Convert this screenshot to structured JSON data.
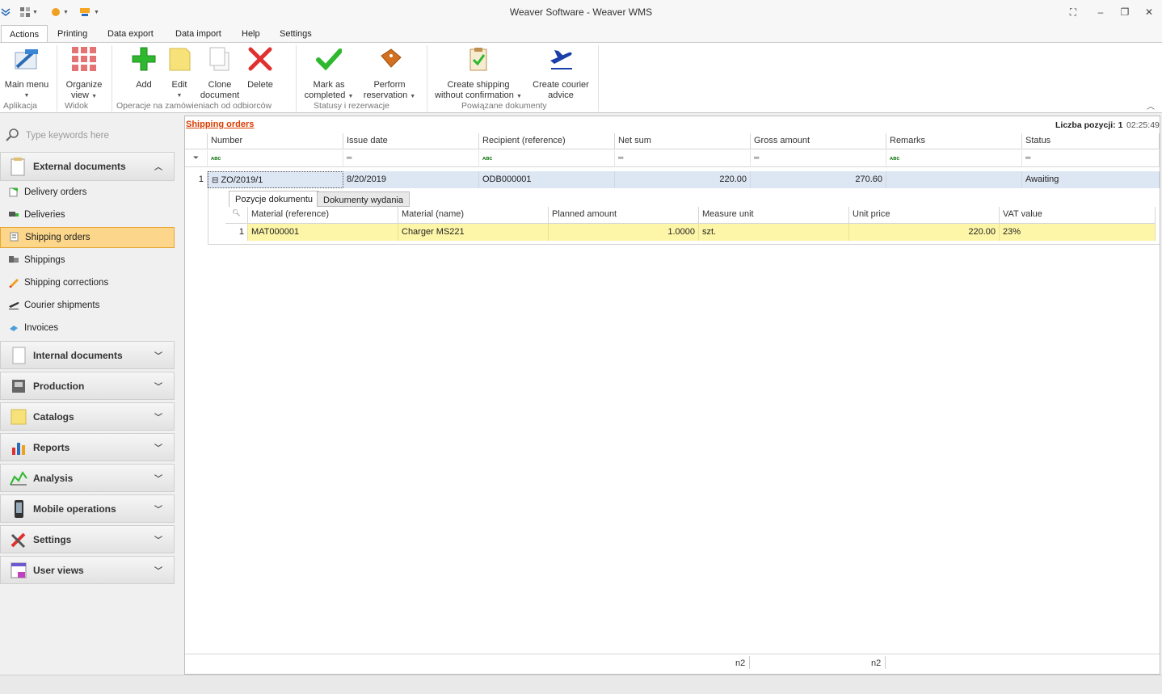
{
  "window": {
    "title": "Weaver Software - Weaver WMS"
  },
  "menu_tabs": [
    {
      "label": "Actions"
    },
    {
      "label": "Printing"
    },
    {
      "label": "Data export"
    },
    {
      "label": "Data import"
    },
    {
      "label": "Help"
    },
    {
      "label": "Settings"
    }
  ],
  "ribbon": {
    "main_menu": "Main menu",
    "organize_view_1": "Organize",
    "organize_view_2": "view",
    "add": "Add",
    "edit": "Edit",
    "clone_1": "Clone",
    "clone_2": "document",
    "delete": "Delete",
    "mark_1": "Mark as",
    "mark_2": "completed",
    "reserve_1": "Perform",
    "reserve_2": "reservation",
    "ship_1": "Create shipping",
    "ship_2": "without confirmation",
    "courier_1": "Create courier",
    "courier_2": "advice",
    "groups": {
      "aplikacja": "Aplikacja",
      "widok": "Widok",
      "operacje": "Operacje na zamówieniach od odbiorców",
      "statusy": "Statusy i rezerwacje",
      "powiazane": "Powiązane dokumenty"
    }
  },
  "sidebar": {
    "search_placeholder": "Type keywords here",
    "external": "External documents",
    "items": [
      {
        "label": "Delivery orders"
      },
      {
        "label": "Deliveries"
      },
      {
        "label": "Shipping orders"
      },
      {
        "label": "Shippings"
      },
      {
        "label": "Shipping corrections"
      },
      {
        "label": "Courier shipments"
      },
      {
        "label": "Invoices"
      }
    ],
    "categories": [
      {
        "label": "Internal documents"
      },
      {
        "label": "Production"
      },
      {
        "label": "Catalogs"
      },
      {
        "label": "Reports"
      },
      {
        "label": "Analysis"
      },
      {
        "label": "Mobile operations"
      },
      {
        "label": "Settings"
      },
      {
        "label": "User views"
      }
    ]
  },
  "grid": {
    "breadcrumb": "Shipping orders",
    "count_label": "Liczba pozycji: 1",
    "time": "02:25:49",
    "columns": [
      "Number",
      "Issue date",
      "Recipient (reference)",
      "Net sum",
      "Gross amount",
      "Remarks",
      "Status"
    ],
    "row": {
      "index": "1",
      "number": "ZO/2019/1",
      "issue_date": "8/20/2019",
      "recipient": "ODB000001",
      "net_sum": "220.00",
      "gross": "270.60",
      "remarks": "",
      "status": "Awaiting"
    },
    "detail_tabs": [
      "Pozycje dokumentu",
      "Dokumenty wydania"
    ],
    "detail_columns": [
      "Material (reference)",
      "Material (name)",
      "Planned amount",
      "Measure unit",
      "Unit price",
      "VAT value"
    ],
    "detail_row": {
      "index": "1",
      "material_ref": "MAT000001",
      "material_name": "Charger MS221",
      "planned": "1.0000",
      "unit": "szt.",
      "price": "220.00",
      "vat": "23%"
    },
    "footer": {
      "net": "n2",
      "gross": "n2"
    }
  },
  "colors": {
    "accent": "#d83b01",
    "selected_item": "#fcd68a",
    "row_highlight": "#dde6f3",
    "detail_highlight": "#fdf6a8"
  }
}
